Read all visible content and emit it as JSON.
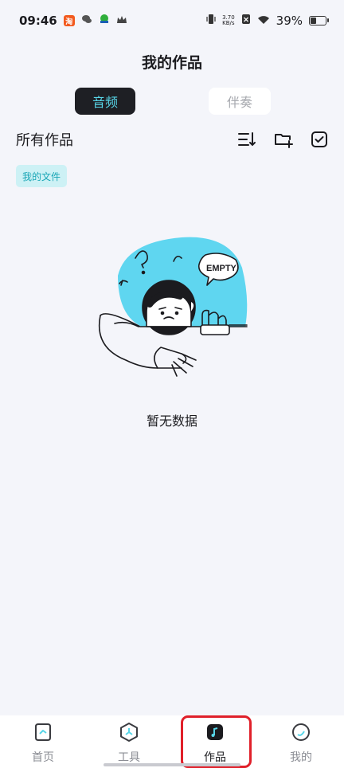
{
  "status_bar": {
    "time": "09:46",
    "net_speed_top": "3.70",
    "net_speed_bottom": "KB/s",
    "battery_percent": "39%",
    "battery_level": 0.39,
    "notification_icons": [
      "taobao-icon",
      "wechat-icon",
      "map-icon",
      "crown-icon"
    ]
  },
  "page": {
    "title": "我的作品"
  },
  "segments": {
    "audio": "音频",
    "accompaniment": "伴奏"
  },
  "section": {
    "title": "所有作品"
  },
  "folder_chip": "我的文件",
  "illustration": {
    "bubble_text": "EMPTY"
  },
  "empty_state": "暂无数据",
  "tabbar": {
    "home": "首页",
    "tools": "工具",
    "works": "作品",
    "mine": "我的"
  },
  "colors": {
    "accent": "#58d6e8",
    "highlight": "#e0202a"
  }
}
